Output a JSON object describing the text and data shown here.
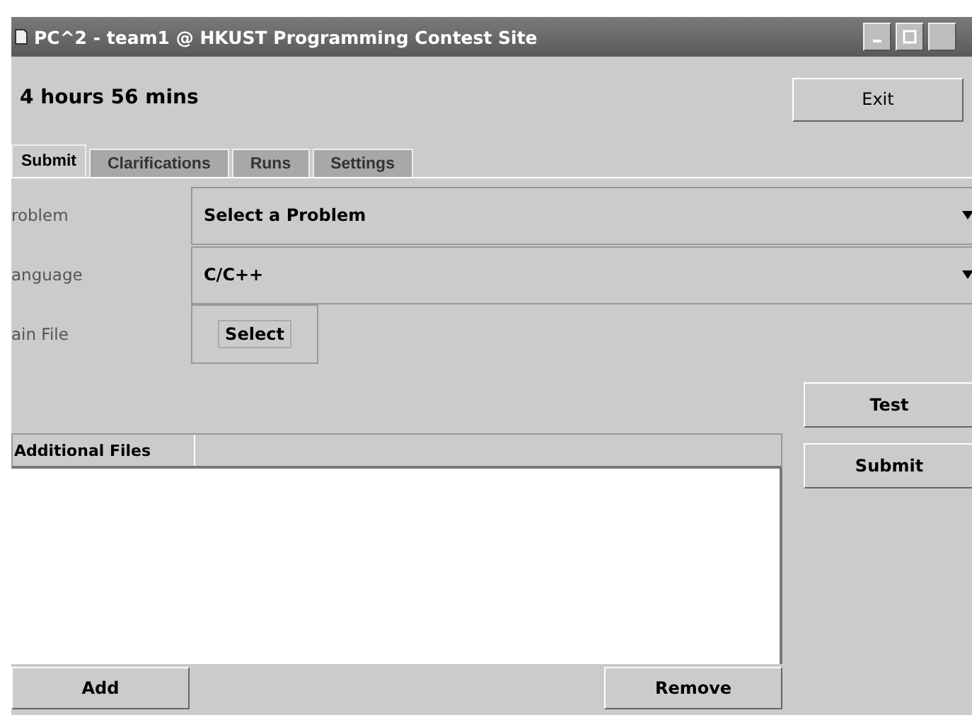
{
  "window": {
    "title": "PC^2 - team1 @ HKUST Programming Contest Site"
  },
  "timer": "4 hours 56 mins",
  "exit_button": "Exit",
  "tabs": [
    {
      "label": "Submit",
      "selected": true
    },
    {
      "label": "Clarifications",
      "selected": false
    },
    {
      "label": "Runs",
      "selected": false
    },
    {
      "label": "Settings",
      "selected": false
    }
  ],
  "form": [
    {
      "kind": "combo",
      "label": "roblem",
      "value": "Select a Problem"
    },
    {
      "kind": "combo",
      "label": "anguage",
      "value": "C/C++"
    },
    {
      "kind": "button",
      "label": "ain File",
      "value": "Select"
    }
  ],
  "actions": [
    "Test",
    "Submit"
  ],
  "files_table": {
    "columns": [
      "Additional Files"
    ]
  },
  "table_buttons": [
    "Add",
    "Remove"
  ]
}
